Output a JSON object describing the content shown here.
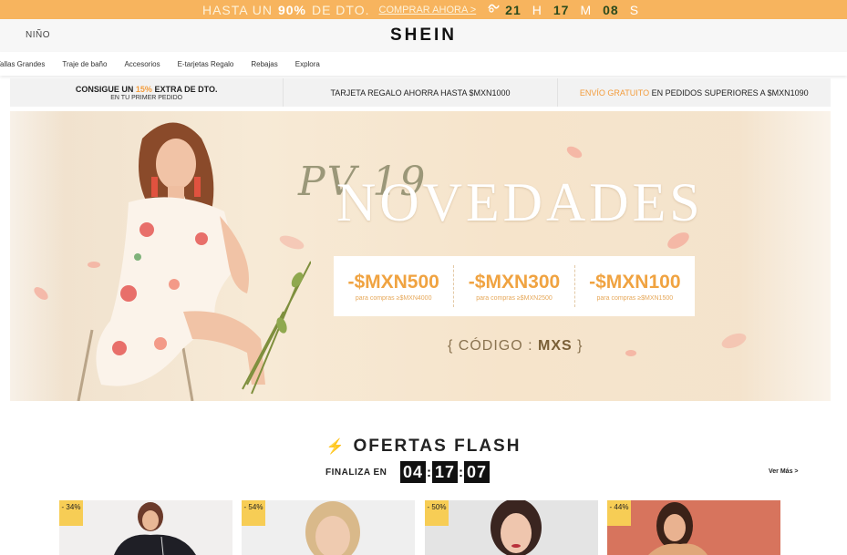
{
  "promo": {
    "text": "HASTA UN",
    "percent": "90%",
    "text2": "DE DTO.",
    "cta": "COMPRAR AHORA >",
    "hours": "21",
    "hours_unit": "H",
    "minutes": "17",
    "minutes_unit": "M",
    "seconds": "08",
    "seconds_unit": "S"
  },
  "header": {
    "left_link": "NIÑO",
    "logo": "SHEIN"
  },
  "nav": {
    "items": [
      "Tallas Grandes",
      "Traje de baño",
      "Accesorios",
      "E-tarjetas Regalo",
      "Rebajas",
      "Explora"
    ]
  },
  "benefits": {
    "b1_pre": "CONSIGUE UN",
    "b1_pct": "15%",
    "b1_post": "EXTRA DE DTO.",
    "b1_sub": "EN TU PRIMER PEDIDO",
    "b2": "TARJETA REGALO AHORRA HASTA $MXN1000",
    "b3_hl": "ENVÍO GRATUITO",
    "b3_post": "EN PEDIDOS SUPERIORES A $MXN1090"
  },
  "hero": {
    "script_text": "PV 19",
    "headline": "NOVEDADES",
    "discounts": [
      {
        "amount": "-$MXN500",
        "condition": "para compras ≥$MXN4000"
      },
      {
        "amount": "-$MXN300",
        "condition": "para compras ≥$MXN2500"
      },
      {
        "amount": "-$MXN100",
        "condition": "para compras ≥$MXN1500"
      }
    ],
    "code_open": "{ CÓDIGO :",
    "code": "MXS",
    "code_close": "}"
  },
  "flash": {
    "title": "OFERTAS FLASH",
    "ends_label": "FINALIZA EN",
    "countdown": [
      "04",
      "17",
      "07"
    ],
    "see_more": "Ver Más >"
  },
  "products": [
    {
      "discount": "- 34%"
    },
    {
      "discount": "- 54%"
    },
    {
      "discount": "- 50%"
    },
    {
      "discount": "- 44%"
    }
  ],
  "colors": {
    "promo_bg": "#f7b45e",
    "accent_orange": "#f39c3c",
    "badge_yellow": "#f7cd55"
  }
}
